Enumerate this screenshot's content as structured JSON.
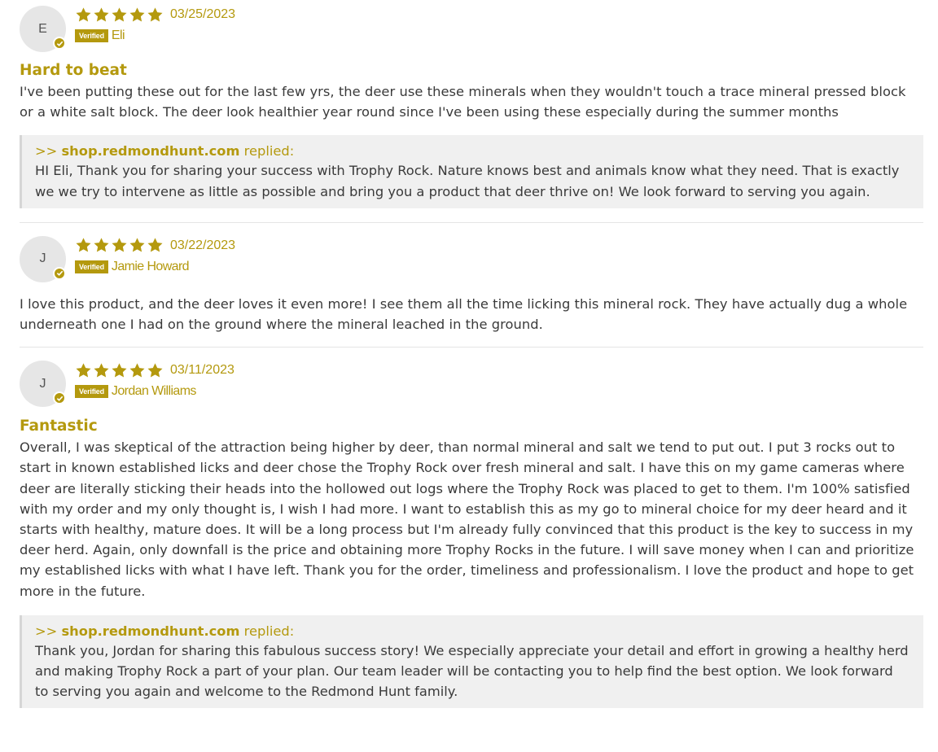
{
  "colors": {
    "accent": "#b4990e",
    "reply_bg": "#f0f0f0",
    "text": "#3a3a3a"
  },
  "reviews": [
    {
      "initial": "E",
      "rating": 5,
      "date": "03/25/2023",
      "verified_label": "Verified",
      "author": "Eli",
      "title": "Hard to beat",
      "body": "I've been putting these out for the last few yrs, the deer use these minerals when they wouldn't touch a trace mineral pressed block or a white salt block. The deer look healthier year round since I've been using these especially during the summer months",
      "reply": {
        "prefix": ">>",
        "store": "shop.redmondhunt.com",
        "replied_label": "replied:",
        "body": "HI Eli, Thank you for sharing your success with Trophy Rock. Nature knows best and animals know what they need. That is exactly we we try to intervene as little as possible and bring you a product that deer thrive on! We look forward to serving you again."
      }
    },
    {
      "initial": "J",
      "rating": 5,
      "date": "03/22/2023",
      "verified_label": "Verified",
      "author": "Jamie Howard",
      "title": "",
      "body": "I love this product, and the deer loves it even more! I see them all the time licking this mineral rock. They have actually dug a whole underneath one I had on the ground where the mineral leached in the ground."
    },
    {
      "initial": "J",
      "rating": 5,
      "date": "03/11/2023",
      "verified_label": "Verified",
      "author": "Jordan Williams",
      "title": "Fantastic",
      "body": "Overall, I was skeptical of the attraction being higher by deer, than normal mineral and salt we tend to put out. I put 3 rocks out to start in known established licks and deer chose the Trophy Rock over fresh mineral and salt. I have this on my game cameras where deer are literally sticking their heads into the hollowed out logs where the Trophy Rock was placed to get to them. I'm 100% satisfied with my order and my only thought is, I wish I had more. I want to establish this as my go to mineral choice for my deer heard and it starts with healthy, mature does. It will be a long process but I'm already fully convinced that this product is the key to success in my deer herd. Again, only downfall is the price and obtaining more Trophy Rocks in the future. I will save money when I can and prioritize my established licks with what I have left. Thank you for the order, timeliness and professionalism. I love the product and hope to get more in the future.",
      "reply": {
        "prefix": ">>",
        "store": "shop.redmondhunt.com",
        "replied_label": "replied:",
        "body": "Thank you, Jordan for sharing this fabulous success story! We especially appreciate your detail and effort in growing a healthy herd and making Trophy Rock a part of your plan. Our team leader will be contacting you to help find the best option. We look forward to serving you again and welcome to the Redmond Hunt family."
      }
    }
  ]
}
